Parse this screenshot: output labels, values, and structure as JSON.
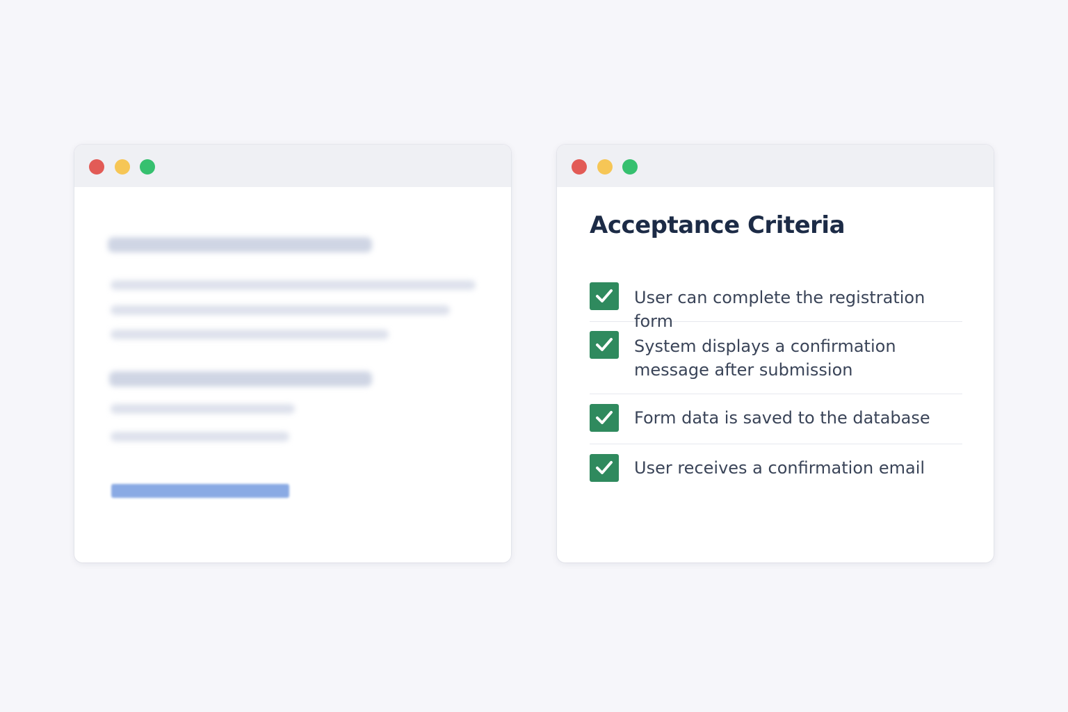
{
  "colors": {
    "traffic_red": "#e25b56",
    "traffic_yellow": "#f6c656",
    "traffic_green": "#36c06f",
    "check_green": "#2f8a5e",
    "title_navy": "#1c2b46"
  },
  "left_window": {
    "traffic_lights": [
      "close-dot",
      "minimize-dot",
      "maximize-dot"
    ],
    "content": "blurred"
  },
  "right_window": {
    "traffic_lights": [
      "close-dot",
      "minimize-dot",
      "maximize-dot"
    ],
    "title": "Acceptance Criteria",
    "criteria": [
      {
        "text": "User can complete the registration form",
        "checked": true,
        "icon": "check-icon"
      },
      {
        "text": "System displays a confirmation message after submission",
        "checked": true,
        "icon": "check-icon"
      },
      {
        "text": "Form data is saved to the database",
        "checked": true,
        "icon": "check-icon"
      },
      {
        "text": "User receives a confirmation email",
        "checked": true,
        "icon": "check-icon"
      }
    ]
  }
}
